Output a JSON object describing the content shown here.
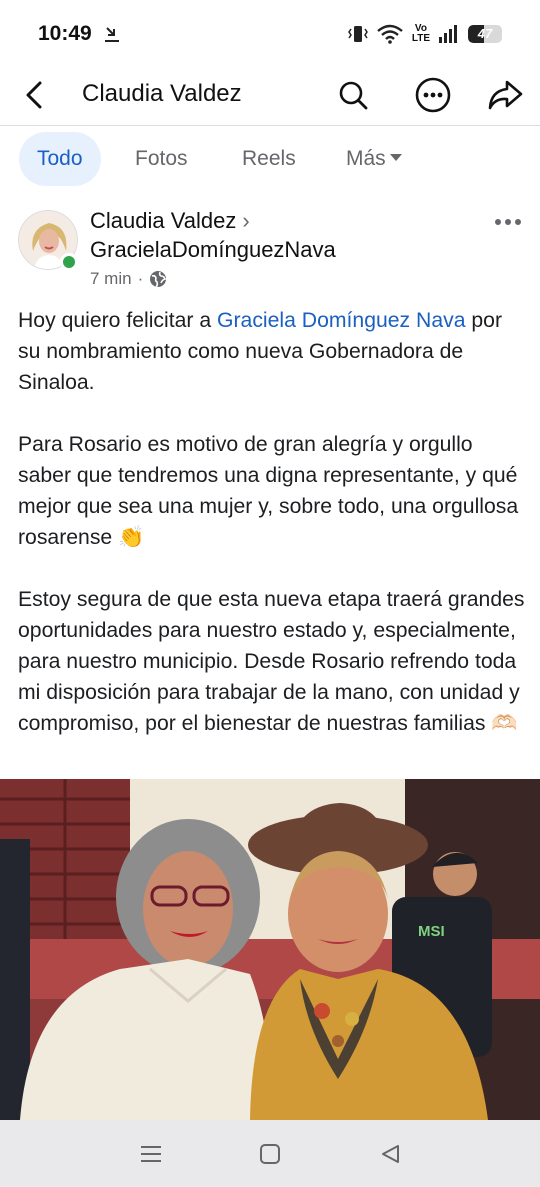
{
  "status_bar": {
    "time": "10:49",
    "volte_top": "Vo",
    "volte_bottom": "LTE",
    "battery": "47",
    "battery_level": 0.47
  },
  "header": {
    "title": "Claudia Valdez"
  },
  "filters": {
    "items": [
      "Todo",
      "Fotos",
      "Reels",
      "Más"
    ],
    "active": "Todo"
  },
  "post": {
    "author": "Claudia Valdez",
    "target": "GracielaDomínguezNava",
    "time": "7 min",
    "separator": "·",
    "paragraph1_before": "Hoy quiero felicitar a ",
    "mention": "Graciela Domínguez Nava",
    "paragraph1_after": " por su nombramiento como nueva Gobernadora de Sinaloa.",
    "paragraph2": "Para Rosario es motivo de gran alegría y orgullo saber que tendremos una digna representante, y qué mejor que sea una mujer y, sobre todo, una orgullosa rosarense 👏",
    "paragraph3": "Estoy segura de que esta nueva etapa traerá grandes oportunidades para nuestro estado y, especialmente, para nuestro municipio. Desde Rosario refrendo toda mi disposición para trabajar de la mano, con unidad y compromiso, por el bienestar de nuestras familias 🫶🏻"
  },
  "photo": {
    "shirt_text": "MSI"
  },
  "colors": {
    "accent": "#1b5fc2",
    "chip_active_bg": "#e7f0fd",
    "online": "#31a24c"
  },
  "icons": [
    "download-icon",
    "vibrate-icon",
    "wifi-icon",
    "signal-icon",
    "battery-icon",
    "back-icon",
    "search-icon",
    "more-icon",
    "share-icon",
    "chevron-right-icon",
    "globe-icon",
    "menu-icon",
    "home-icon",
    "back-triangle-icon"
  ]
}
